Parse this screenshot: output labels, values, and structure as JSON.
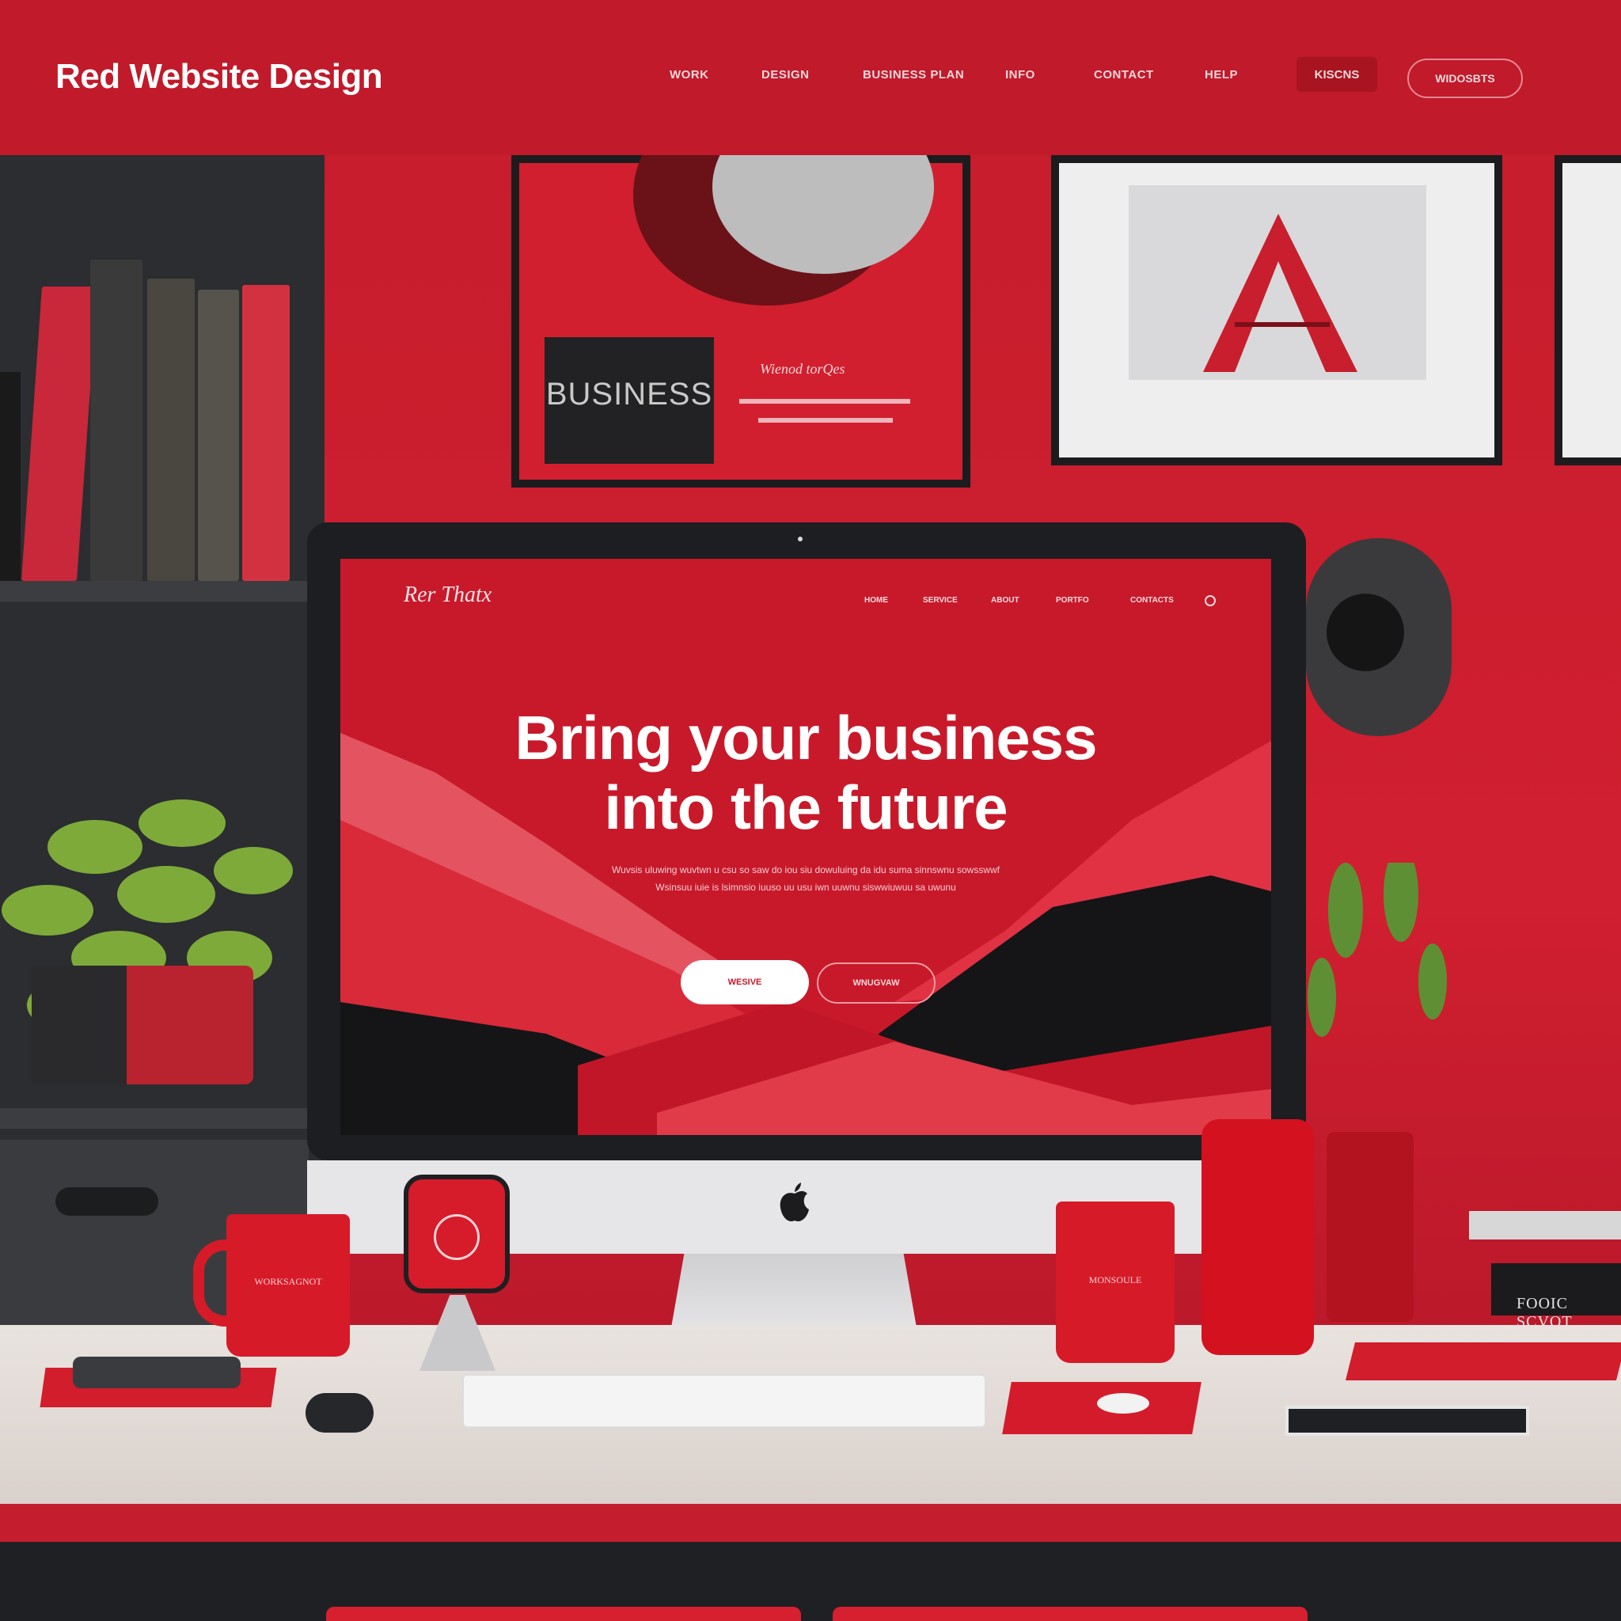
{
  "header": {
    "brand": "Red Website Design",
    "nav": [
      "WORK",
      "DESIGN",
      "BUSINESS PLAN",
      "INFO",
      "CONTACT",
      "HELP"
    ],
    "button_filled": "KISCNS",
    "button_outline": "WIDOSBTS"
  },
  "scene": {
    "frame_business": {
      "title": "BUSINESS",
      "note": "Wienod torQes"
    },
    "books_label": "FOOIC SCVOT"
  },
  "monitor_site": {
    "logo": "Rer Thatx",
    "nav": [
      "HOME",
      "SERVICE",
      "ABOUT",
      "PORTFO",
      "CONTACTS"
    ],
    "hero_line1": "Bring your business",
    "hero_line2": "into the future",
    "subtext_line1": "Wuvsis uluwing wuvtwn u csu so saw do iou siu dowuluing da idu suma sinnswnu sowsswwf",
    "subtext_line2": "Wsinsuu iuie is lsimnsio iuuso uu usu iwn uuwnu siswwiuwuu sa uwunu",
    "cta_primary": "WESIVE",
    "cta_secondary": "WNUGVAW"
  },
  "mugs": {
    "left": "WORKSAGNOT",
    "right": "MONSOULE"
  },
  "colors": {
    "brand_red": "#c01a2b",
    "screen_red": "#c8192b",
    "dark": "#1d1e21",
    "white": "#ffffff"
  }
}
